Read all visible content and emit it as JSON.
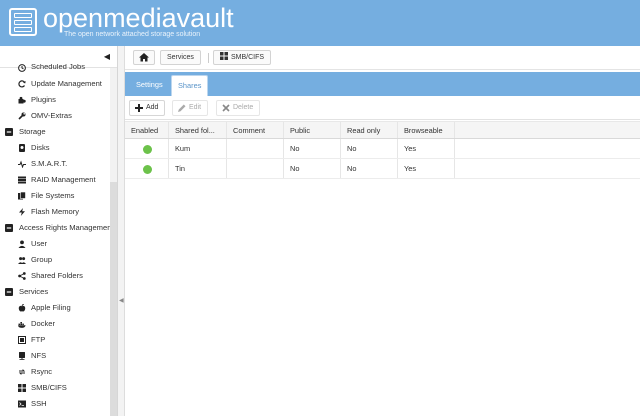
{
  "app": {
    "title": "openmediavault",
    "subtitle": "The open network attached storage solution"
  },
  "colors": {
    "header_bg": "#75aee0",
    "tab_bg": "#75aee0",
    "enabled_dot": "#6cc24a"
  },
  "sidebar": {
    "items": [
      {
        "label": "Scheduled Jobs",
        "type": "child",
        "icon": "clock-icon"
      },
      {
        "label": "Update Management",
        "type": "child",
        "icon": "refresh-icon"
      },
      {
        "label": "Plugins",
        "type": "child",
        "icon": "puzzle-icon"
      },
      {
        "label": "OMV-Extras",
        "type": "child",
        "icon": "wrench-icon"
      },
      {
        "label": "Storage",
        "type": "group",
        "icon": "minus-square-icon"
      },
      {
        "label": "Disks",
        "type": "child",
        "icon": "disk-icon"
      },
      {
        "label": "S.M.A.R.T.",
        "type": "child",
        "icon": "pulse-icon"
      },
      {
        "label": "RAID Management",
        "type": "child",
        "icon": "raid-icon"
      },
      {
        "label": "File Systems",
        "type": "child",
        "icon": "files-icon"
      },
      {
        "label": "Flash Memory",
        "type": "child",
        "icon": "flash-icon"
      },
      {
        "label": "Access Rights Management",
        "type": "group",
        "icon": "minus-square-icon"
      },
      {
        "label": "User",
        "type": "child",
        "icon": "user-icon"
      },
      {
        "label": "Group",
        "type": "child",
        "icon": "group-icon"
      },
      {
        "label": "Shared Folders",
        "type": "child",
        "icon": "share-icon"
      },
      {
        "label": "Services",
        "type": "group",
        "icon": "minus-square-icon"
      },
      {
        "label": "Apple Filing",
        "type": "child",
        "icon": "apple-icon"
      },
      {
        "label": "Docker",
        "type": "child",
        "icon": "docker-icon"
      },
      {
        "label": "FTP",
        "type": "child",
        "icon": "ftp-icon"
      },
      {
        "label": "NFS",
        "type": "child",
        "icon": "server-icon"
      },
      {
        "label": "Rsync",
        "type": "child",
        "icon": "rsync-icon"
      },
      {
        "label": "SMB/CIFS",
        "type": "child",
        "icon": "windows-icon"
      },
      {
        "label": "SSH",
        "type": "child",
        "icon": "terminal-icon"
      }
    ]
  },
  "breadcrumb": {
    "home_icon": "home-icon",
    "items": [
      "Services",
      "SMB/CIFS"
    ]
  },
  "tabs": [
    {
      "label": "Settings",
      "active": false
    },
    {
      "label": "Shares",
      "active": true
    }
  ],
  "toolbar": {
    "add_label": "Add",
    "edit_label": "Edit",
    "delete_label": "Delete"
  },
  "grid": {
    "columns": [
      "Enabled",
      "Shared fol...",
      "Comment",
      "Public",
      "Read only",
      "Browseable"
    ],
    "rows": [
      {
        "enabled": true,
        "shared_folder": "Kum",
        "comment": "",
        "public": "No",
        "read_only": "No",
        "browseable": "Yes"
      },
      {
        "enabled": true,
        "shared_folder": "Tin",
        "comment": "",
        "public": "No",
        "read_only": "No",
        "browseable": "Yes"
      }
    ]
  }
}
